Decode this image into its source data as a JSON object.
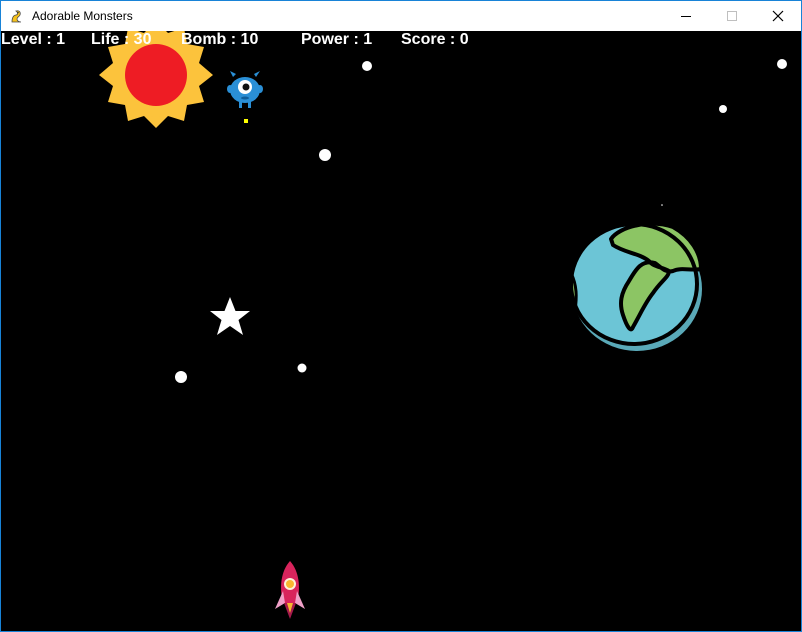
{
  "window": {
    "title": "Adorable Monsters",
    "app_icon": "pygame-snake-icon",
    "controls": [
      "minimize-icon",
      "maximize-icon",
      "close-icon"
    ]
  },
  "hud": {
    "level": "Level : 1",
    "life": "Life : 30",
    "bomb": "Bomb : 10",
    "power": "Power : 1",
    "score": "Score : 0"
  },
  "colors": {
    "background": "#000000",
    "sun_core": "#ee1c24",
    "sun_rays": "#fcc33c",
    "planet_ocean": "#6cc5d6",
    "planet_land": "#8cc564",
    "monster": "#2a8fd6",
    "monster_bullet": "#ffff00",
    "rocket": "#d8245c"
  },
  "sprites": {
    "sun": "sun",
    "planet": "earth-planet",
    "monster": "blue-one-eyed-monster",
    "player": "pink-rocket",
    "star": "white-star",
    "bullet": "yellow-bullet"
  }
}
